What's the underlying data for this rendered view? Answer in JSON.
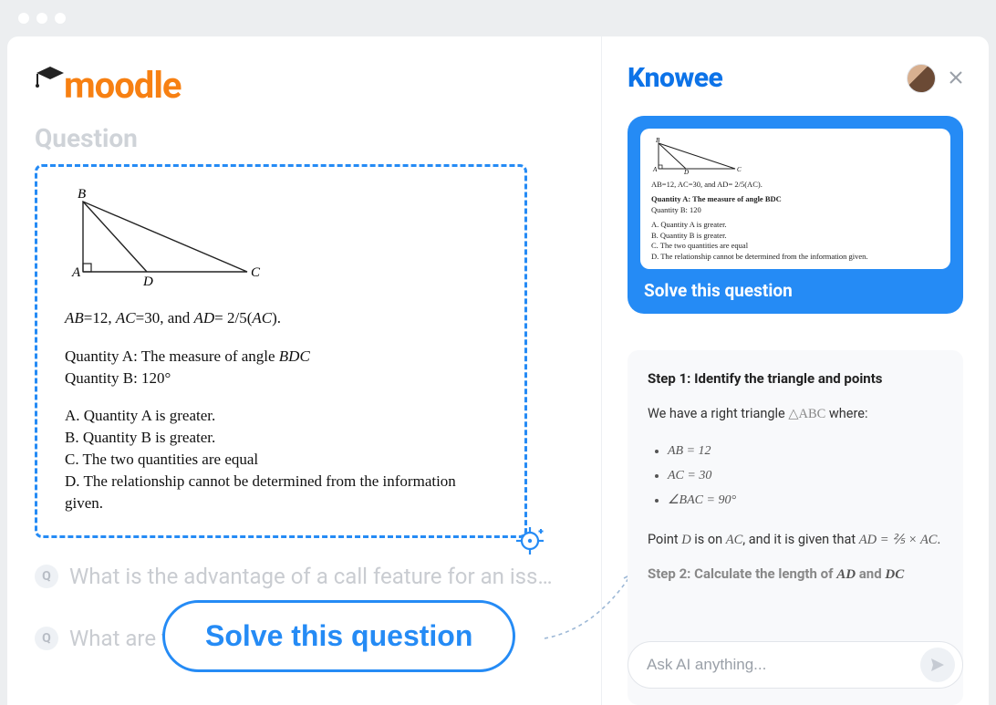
{
  "left": {
    "logo_text": "moodle",
    "heading": "Question",
    "question": {
      "given_line": "AB=12, AC=30, and AD= 2/5(AC).",
      "qa_label": "Quantity A: The measure of angle BDC",
      "qb_label": "Quantity B: 120°",
      "opt_a": "A. Quantity A is greater.",
      "opt_b": "B. Quantity B is greater.",
      "opt_c": "C. The two quantities are equal",
      "opt_d": "D. The relationship cannot be determined from the information given.",
      "triangle": {
        "A": "A",
        "B": "B",
        "C": "C",
        "D": "D"
      }
    },
    "faded_q1": "What is the advantage of a call feature for an iss…",
    "faded_q2": "What are the disadvantages of a call…",
    "q_badge": "Q",
    "solve_button": "Solve this question"
  },
  "right": {
    "logo": "Knowee",
    "capture_label": "Solve this question",
    "thumb": {
      "line1": "AB=12, AC=30, and AD= 2/5(AC).",
      "line2a": "Quantity A: The measure of angle BDC",
      "line2b": "Quantity B: 120",
      "oa": "A. Quantity A is greater.",
      "ob": "B. Quantity B is greater.",
      "oc": "C. The two quantities are equal",
      "od": "D. The relationship cannot be determined from the information given."
    },
    "answer": {
      "step1_title": "Step 1: Identify the triangle and points",
      "intro_pre": "We have a right triangle ",
      "intro_tri": "△ABC",
      "intro_post": " where:",
      "bul1": "AB = 12",
      "bul2": "AC = 30",
      "bul3": "∠BAC = 90°",
      "p2_a": "Point ",
      "p2_D": "D",
      "p2_b": " is on ",
      "p2_AC": "AC",
      "p2_c": ", and it is given that ",
      "p2_eq": "AD = ⅖ × AC",
      "p2_d": ".",
      "step2_title_pre": "Step 2: Calculate the length of ",
      "step2_AD": "AD",
      "step2_and": " and ",
      "step2_DC": "DC"
    },
    "input_placeholder": "Ask AI anything..."
  }
}
